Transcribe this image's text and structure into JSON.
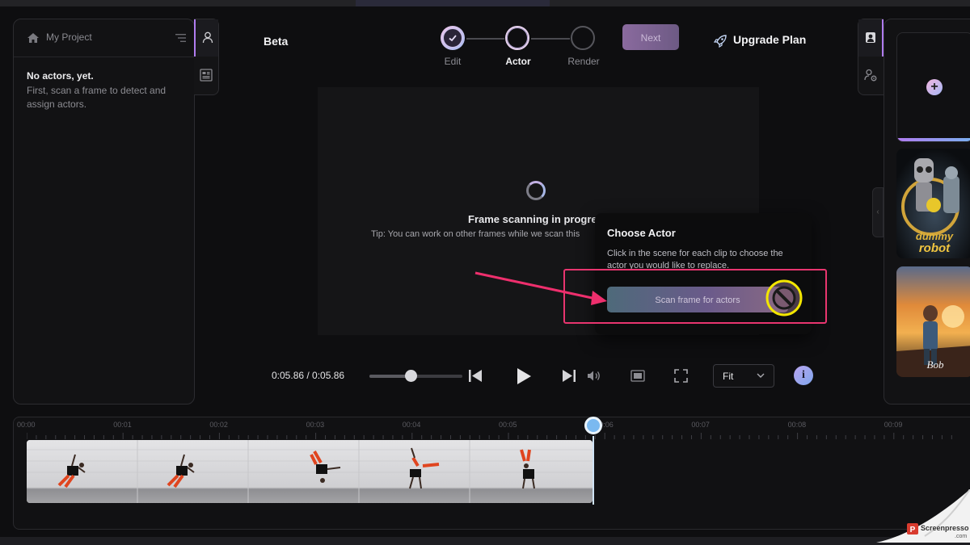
{
  "left_panel": {
    "project_name": "My Project",
    "empty_title": "No actors, yet.",
    "empty_desc": "First, scan a frame to detect and assign actors."
  },
  "header": {
    "beta_label": "Beta",
    "steps": [
      {
        "label": "Edit",
        "state": "done"
      },
      {
        "label": "Actor",
        "state": "active"
      },
      {
        "label": "Render",
        "state": "pending"
      }
    ],
    "next_label": "Next",
    "upgrade_label": "Upgrade Plan"
  },
  "preview": {
    "scan_title": "Frame scanning in progre",
    "scan_tip": "Tip: You can work on other frames while we scan this"
  },
  "popover": {
    "title": "Choose Actor",
    "desc": "Click in the scene for each clip to choose the actor you would like to replace.",
    "scan_button": "Scan frame for actors"
  },
  "controls": {
    "time": "0:05.86 / 0:05.86",
    "fit_value": "Fit",
    "scrub_position": 0.45
  },
  "timeline": {
    "ticks": [
      "00:00",
      "00:01",
      "00:02",
      "00:03",
      "00:04",
      "00:05",
      "00:06",
      "00:07",
      "00:08",
      "00:09"
    ],
    "playhead_time": "00:05.86"
  },
  "right_panel": {
    "actor_cards": [
      {
        "name": "dummy-robot",
        "text": "dummy robot"
      },
      {
        "name": "bob",
        "text": "Bob"
      }
    ]
  },
  "watermark": {
    "text_line1": "Screenpresso",
    "text_line2": ".com"
  },
  "colors": {
    "accent": "#b07cf0",
    "highlight": "#e8356f",
    "playhead": "#7ab9f0"
  }
}
